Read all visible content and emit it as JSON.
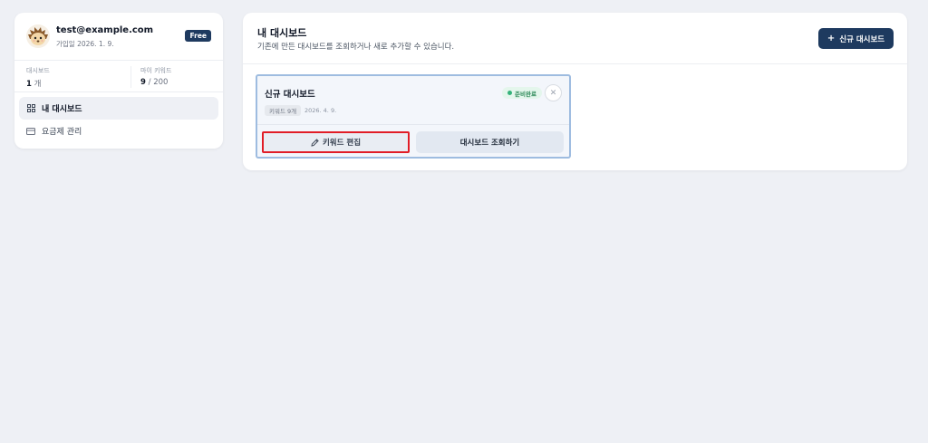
{
  "sidebar": {
    "profile": {
      "email": "test@example.com",
      "joined": "가입일 2026. 1. 9.",
      "plan_badge": "Free",
      "avatar_icon": "hedgehog-avatar-icon"
    },
    "stats": {
      "dashboards_label": "대시보드",
      "dashboards_count": "1",
      "dashboards_unit": " 개",
      "keywords_label": "마이 키워드",
      "keywords_used": "9",
      "keywords_total": " / 200"
    },
    "menu": [
      {
        "label": "내 대시보드",
        "icon": "grid-icon",
        "active": true
      },
      {
        "label": "요금제 관리",
        "icon": "credit-card-icon",
        "active": false
      }
    ]
  },
  "main": {
    "title": "내 대시보드",
    "subtitle": "기존에 만든 대시보드를 조회하거나 새로 추가할 수 있습니다.",
    "new_button_label": "신규 대시보드",
    "dashboards": [
      {
        "title": "신규 대시보드",
        "status": "준비완료",
        "keyword_chip": "키워드 9개",
        "date": "2026. 4. 9.",
        "edit_label": "키워드 편집",
        "view_label": "대시보드 조회하기"
      }
    ]
  },
  "colors": {
    "brand_dark": "#1e3a5f",
    "status_green": "#34b27a",
    "highlight_red": "#e11d26",
    "card_border": "#9ebce0"
  }
}
